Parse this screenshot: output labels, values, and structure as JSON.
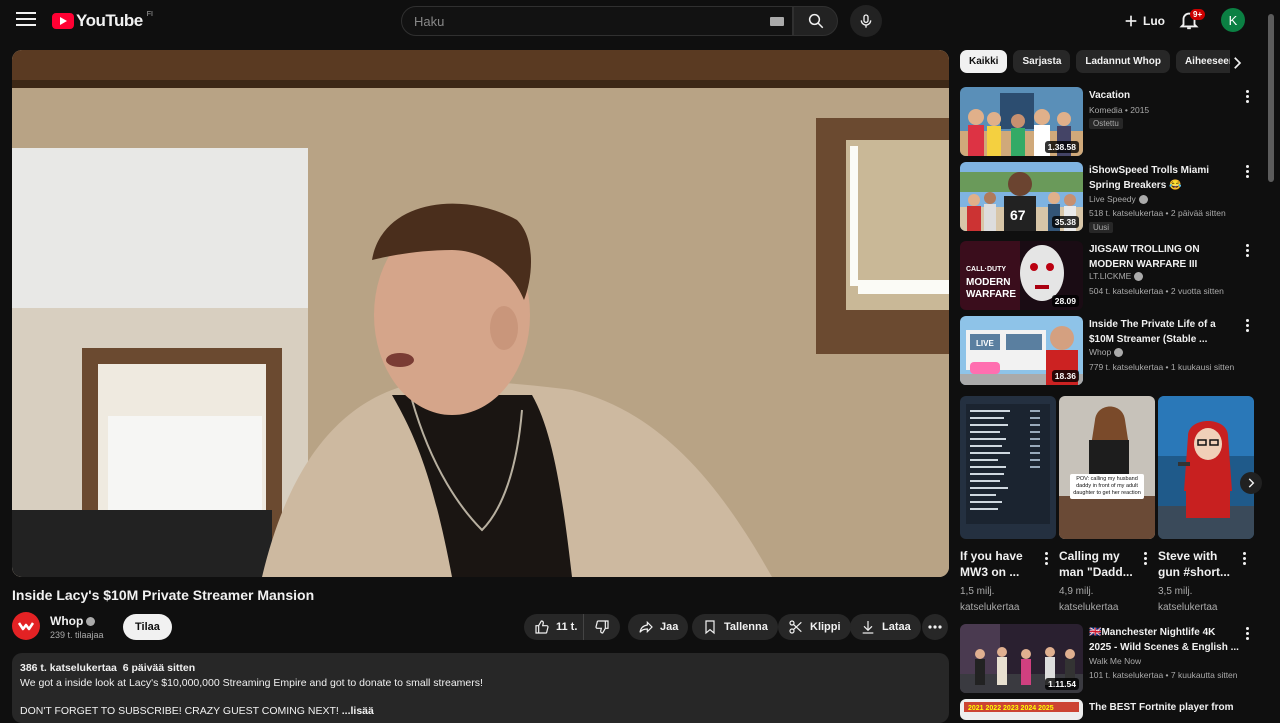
{
  "header": {
    "logo_text": "YouTube",
    "region": "FI",
    "search_placeholder": "Haku",
    "create_label": "Luo",
    "notif_count": "9+",
    "avatar_letter": "K"
  },
  "video": {
    "title": "Inside Lacy's $10M Private Streamer Mansion",
    "channel": "Whop",
    "subscribers": "239 t. tilaajaa",
    "subscribe_label": "Tilaa",
    "likes": "11 t.",
    "share_label": "Jaa",
    "save_label": "Tallenna",
    "clip_label": "Klippi",
    "download_label": "Lataa"
  },
  "description": {
    "views": "386 t. katselukertaa",
    "age": "6 päivää sitten",
    "line1": "We got a inside look at Lacy's $10,000,000 Streaming Empire and got to donate to small streamers!",
    "line2": "DON'T FORGET TO SUBSCRIBE! CRAZY GUEST COMING NEXT!",
    "more": "...lisää"
  },
  "chips": [
    "Kaikki",
    "Sarjasta",
    "Ladannut Whop",
    "Aiheeseen"
  ],
  "recommendations": [
    {
      "title": "Vacation",
      "channel": "Komedia • 2015",
      "verified": false,
      "meta": "",
      "tag": "Ostettu",
      "duration": "1.38.58"
    },
    {
      "title": "iShowSpeed Trolls Miami Spring Breakers 😂",
      "channel": "Live Speedy",
      "verified": true,
      "meta": "518 t. katselukertaa • 2 päivää sitten",
      "tag": "Uusi",
      "duration": "35.38"
    },
    {
      "title": "JIGSAW TROLLING ON MODERN WARFARE III",
      "channel": "LT.LICKME",
      "verified": true,
      "meta": "504 t. katselukertaa • 2 vuotta sitten",
      "tag": "",
      "duration": "28.09"
    },
    {
      "title": "Inside The Private Life of a $10M Streamer (Stable ...",
      "channel": "Whop",
      "verified": true,
      "meta": "779 t. katselukertaa • 1 kuukausi sitten",
      "tag": "",
      "duration": "18.36"
    },
    {
      "title": "🇬🇧Manchester Nightlife 4K 2025 - Wild Scenes & English ...",
      "channel": "Walk Me Now",
      "verified": false,
      "meta": "101 t. katselukertaa • 7 kuukautta sitten",
      "tag": "",
      "duration": "1.11.54"
    },
    {
      "title": "The BEST Fortnite player from",
      "channel": "",
      "verified": false,
      "meta": "",
      "tag": "",
      "duration": ""
    }
  ],
  "shorts": [
    {
      "title": "If you have MW3 on ...",
      "views": "1,5 milj. katselukertaa"
    },
    {
      "title": "Calling my man \"Dadd...",
      "views": "4,9 milj. katselukertaa"
    },
    {
      "title": "Steve with gun #short...",
      "views": "3,5 milj. katselukertaa"
    }
  ],
  "short2_caption": "POV: calling my husband daddy in front of my adult daughter to get her reaction"
}
